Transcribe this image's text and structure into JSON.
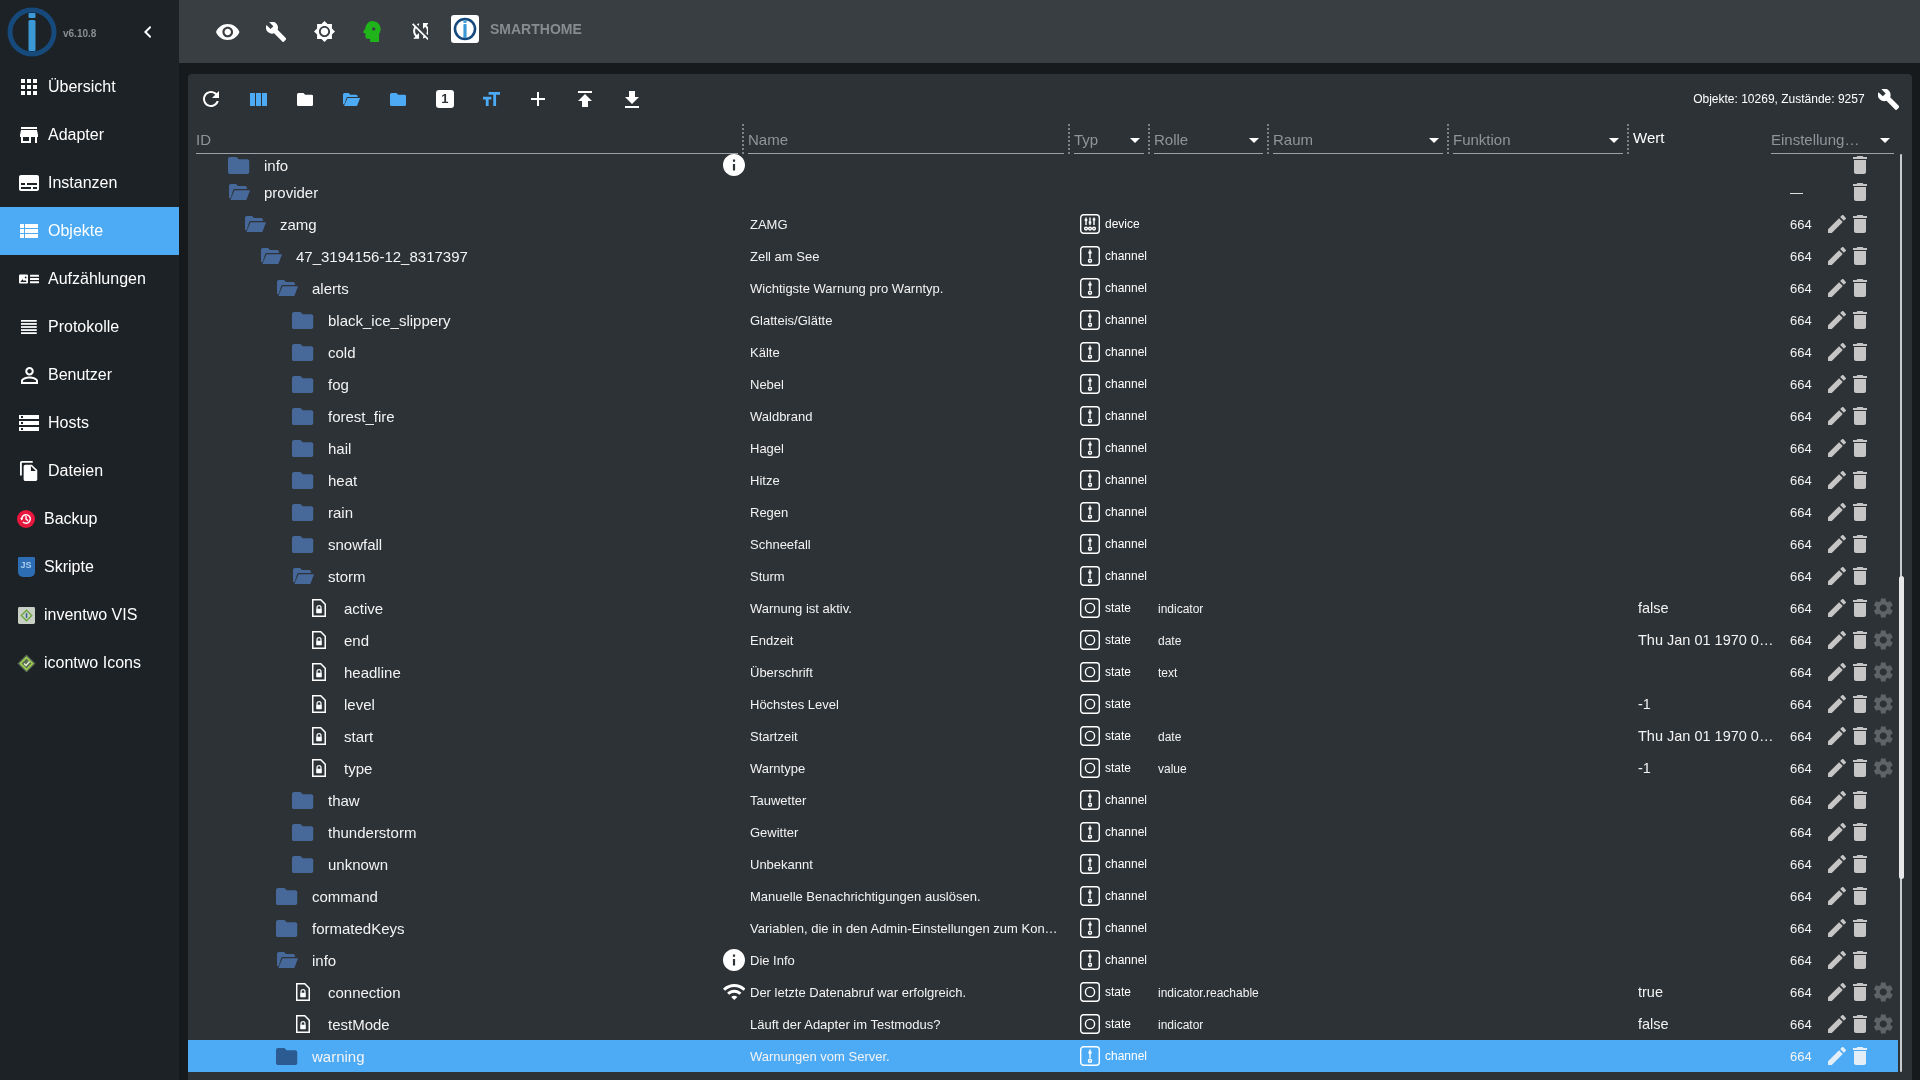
{
  "sidebar": {
    "version": "v6.10.8",
    "items": [
      {
        "label": "Übersicht",
        "kind": "apps",
        "selected": false
      },
      {
        "label": "Adapter",
        "kind": "store",
        "selected": false
      },
      {
        "label": "Instanzen",
        "kind": "instances",
        "selected": false
      },
      {
        "label": "Objekte",
        "kind": "objects",
        "selected": true
      },
      {
        "label": "Aufzählungen",
        "kind": "enums",
        "selected": false
      },
      {
        "label": "Protokolle",
        "kind": "logs",
        "selected": false
      },
      {
        "label": "Benutzer",
        "kind": "users",
        "selected": false
      },
      {
        "label": "Hosts",
        "kind": "hosts",
        "selected": false
      },
      {
        "label": "Dateien",
        "kind": "files",
        "selected": false
      },
      {
        "label": "Backup",
        "kind": "backup",
        "selected": false
      },
      {
        "label": "Skripte",
        "kind": "scripts",
        "logo_text": "JS",
        "selected": false
      },
      {
        "label": "inventwo VIS",
        "kind": "vis",
        "selected": false
      },
      {
        "label": "icontwo Icons",
        "kind": "icons",
        "selected": false
      }
    ]
  },
  "top_bar": {
    "brand": "SMARTHOME"
  },
  "toolbar": {
    "buttons": [
      {
        "kind": "refresh",
        "on": false
      },
      {
        "kind": "columns",
        "on": true
      },
      {
        "kind": "folder",
        "on": false
      },
      {
        "kind": "folder-open",
        "on": true
      },
      {
        "kind": "folder",
        "on": true
      },
      {
        "kind": "number",
        "label": "1",
        "on": false
      },
      {
        "kind": "text-size",
        "on": true
      },
      {
        "kind": "add",
        "on": false
      },
      {
        "kind": "upload",
        "on": false
      },
      {
        "kind": "download",
        "on": false
      }
    ],
    "counts": "Objekte: 10269, Zustände: 9257"
  },
  "objects": {
    "columns": [
      {
        "kind": "filter",
        "placeholder": "ID"
      },
      {
        "kind": "filter",
        "placeholder": "Name"
      },
      {
        "kind": "select",
        "label": "Typ"
      },
      {
        "kind": "select",
        "label": "Rolle"
      },
      {
        "kind": "select",
        "label": "Raum"
      },
      {
        "kind": "select",
        "label": "Funktion"
      },
      {
        "kind": "label",
        "label": "Wert"
      },
      {
        "kind": "select",
        "label": "Einstellung…"
      }
    ],
    "rows": [
      {
        "label": "info",
        "kind": "folder",
        "expanded": false,
        "name_icon": {
          "kind": "info"
        },
        "selected": false
      },
      {
        "label": "provider",
        "kind": "folder",
        "expanded": true,
        "acl": "—",
        "selected": false,
        "children": [
          {
            "label": "zamg",
            "kind": "device",
            "expanded": true,
            "name": "ZAMG",
            "type": "device",
            "acl": "664",
            "selected": false,
            "children": [
              {
                "label": "47_3194156-12_8317397",
                "kind": "channel",
                "expanded": true,
                "name": "Zell am See",
                "type": "channel",
                "acl": "664",
                "selected": false,
                "children": [
                  {
                    "label": "alerts",
                    "kind": "channel",
                    "expanded": true,
                    "name": "Wichtigste Warnung pro Warntyp.",
                    "type": "channel",
                    "acl": "664",
                    "selected": false,
                    "children": [
                      {
                        "label": "black_ice_slippery",
                        "kind": "channel",
                        "expanded": false,
                        "name": "Glatteis/Glätte",
                        "type": "channel",
                        "acl": "664",
                        "selected": false
                      },
                      {
                        "label": "cold",
                        "kind": "channel",
                        "expanded": false,
                        "name": "Kälte",
                        "type": "channel",
                        "acl": "664",
                        "selected": false
                      },
                      {
                        "label": "fog",
                        "kind": "channel",
                        "expanded": false,
                        "name": "Nebel",
                        "type": "channel",
                        "acl": "664",
                        "selected": false
                      },
                      {
                        "label": "forest_fire",
                        "kind": "channel",
                        "expanded": false,
                        "name": "Waldbrand",
                        "type": "channel",
                        "acl": "664",
                        "selected": false
                      },
                      {
                        "label": "hail",
                        "kind": "channel",
                        "expanded": false,
                        "name": "Hagel",
                        "type": "channel",
                        "acl": "664",
                        "selected": false
                      },
                      {
                        "label": "heat",
                        "kind": "channel",
                        "expanded": false,
                        "name": "Hitze",
                        "type": "channel",
                        "acl": "664",
                        "selected": false
                      },
                      {
                        "label": "rain",
                        "kind": "channel",
                        "expanded": false,
                        "name": "Regen",
                        "type": "channel",
                        "acl": "664",
                        "selected": false
                      },
                      {
                        "label": "snowfall",
                        "kind": "channel",
                        "expanded": false,
                        "name": "Schneefall",
                        "type": "channel",
                        "acl": "664",
                        "selected": false
                      },
                      {
                        "label": "storm",
                        "kind": "channel",
                        "expanded": true,
                        "name": "Sturm",
                        "type": "channel",
                        "acl": "664",
                        "selected": false,
                        "children": [
                          {
                            "label": "active",
                            "kind": "state",
                            "name": "Warnung ist aktiv.",
                            "type": "state",
                            "role": "indicator",
                            "value": "false",
                            "acl": "664",
                            "selected": false
                          },
                          {
                            "label": "end",
                            "kind": "state",
                            "name": "Endzeit",
                            "type": "state",
                            "role": "date",
                            "value": "Thu Jan 01 1970 0…",
                            "acl": "664",
                            "selected": false
                          },
                          {
                            "label": "headline",
                            "kind": "state",
                            "name": "Überschrift",
                            "type": "state",
                            "role": "text",
                            "acl": "664",
                            "selected": false
                          },
                          {
                            "label": "level",
                            "kind": "state",
                            "name": "Höchstes Level",
                            "type": "state",
                            "value": "-1",
                            "acl": "664",
                            "selected": false
                          },
                          {
                            "label": "start",
                            "kind": "state",
                            "name": "Startzeit",
                            "type": "state",
                            "role": "date",
                            "value": "Thu Jan 01 1970 0…",
                            "acl": "664",
                            "selected": false
                          },
                          {
                            "label": "type",
                            "kind": "state",
                            "name": "Warntype",
                            "type": "state",
                            "role": "value",
                            "value": "-1",
                            "acl": "664",
                            "selected": false
                          }
                        ]
                      },
                      {
                        "label": "thaw",
                        "kind": "channel",
                        "expanded": false,
                        "name": "Tauwetter",
                        "type": "channel",
                        "acl": "664",
                        "selected": false
                      },
                      {
                        "label": "thunderstorm",
                        "kind": "channel",
                        "expanded": false,
                        "name": "Gewitter",
                        "type": "channel",
                        "acl": "664",
                        "selected": false
                      },
                      {
                        "label": "unknown",
                        "kind": "channel",
                        "expanded": false,
                        "name": "Unbekannt",
                        "type": "channel",
                        "acl": "664",
                        "selected": false
                      }
                    ]
                  },
                  {
                    "label": "command",
                    "kind": "channel",
                    "expanded": false,
                    "name": "Manuelle Benachrichtigungen auslösen.",
                    "type": "channel",
                    "acl": "664",
                    "selected": false
                  },
                  {
                    "label": "formatedKeys",
                    "kind": "channel",
                    "expanded": false,
                    "name": "Variablen, die in den Admin-Einstellungen zum Kon…",
                    "type": "channel",
                    "acl": "664",
                    "selected": false
                  },
                  {
                    "label": "info",
                    "kind": "channel",
                    "expanded": true,
                    "name_icon": {
                      "kind": "info"
                    },
                    "name": "Die Info",
                    "type": "channel",
                    "acl": "664",
                    "selected": false,
                    "children": [
                      {
                        "label": "connection",
                        "kind": "state",
                        "name_icon": {
                          "kind": "wifi"
                        },
                        "name": "Der letzte Datenabruf war erfolgreich.",
                        "type": "state",
                        "role": "indicator.reachable",
                        "value": "true",
                        "acl": "664",
                        "selected": false
                      },
                      {
                        "label": "testMode",
                        "kind": "state",
                        "name": "Läuft der Adapter im Testmodus?",
                        "type": "state",
                        "role": "indicator",
                        "value": "false",
                        "acl": "664",
                        "selected": false
                      }
                    ]
                  },
                  {
                    "label": "warning",
                    "kind": "channel",
                    "expanded": false,
                    "name": "Warnungen vom Server.",
                    "type": "channel",
                    "acl": "664",
                    "selected": true
                  }
                ]
              }
            ]
          }
        ]
      }
    ]
  }
}
